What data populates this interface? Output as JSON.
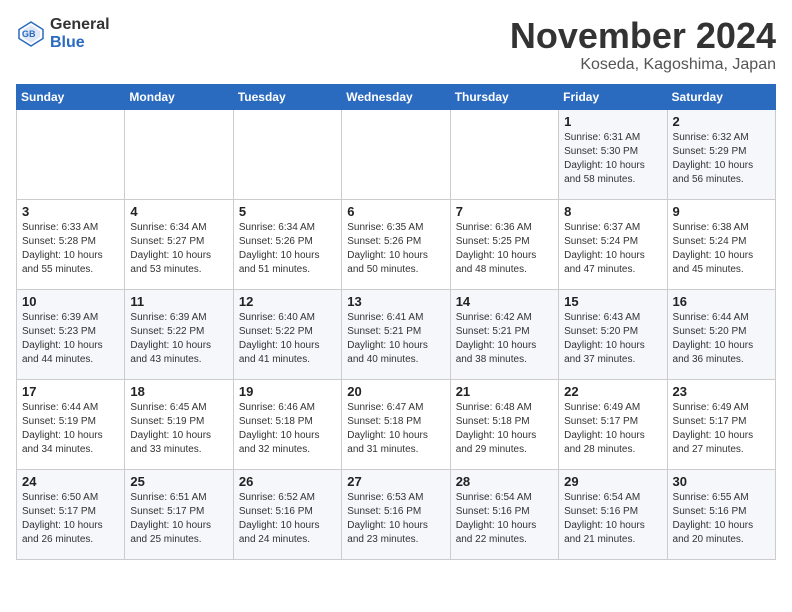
{
  "header": {
    "logo_general": "General",
    "logo_blue": "Blue",
    "month_title": "November 2024",
    "location": "Koseda, Kagoshima, Japan"
  },
  "days_of_week": [
    "Sunday",
    "Monday",
    "Tuesday",
    "Wednesday",
    "Thursday",
    "Friday",
    "Saturday"
  ],
  "weeks": [
    [
      {
        "day": "",
        "sunrise": "",
        "sunset": "",
        "daylight": ""
      },
      {
        "day": "",
        "sunrise": "",
        "sunset": "",
        "daylight": ""
      },
      {
        "day": "",
        "sunrise": "",
        "sunset": "",
        "daylight": ""
      },
      {
        "day": "",
        "sunrise": "",
        "sunset": "",
        "daylight": ""
      },
      {
        "day": "",
        "sunrise": "",
        "sunset": "",
        "daylight": ""
      },
      {
        "day": "1",
        "sunrise": "Sunrise: 6:31 AM",
        "sunset": "Sunset: 5:30 PM",
        "daylight": "Daylight: 10 hours and 58 minutes."
      },
      {
        "day": "2",
        "sunrise": "Sunrise: 6:32 AM",
        "sunset": "Sunset: 5:29 PM",
        "daylight": "Daylight: 10 hours and 56 minutes."
      }
    ],
    [
      {
        "day": "3",
        "sunrise": "Sunrise: 6:33 AM",
        "sunset": "Sunset: 5:28 PM",
        "daylight": "Daylight: 10 hours and 55 minutes."
      },
      {
        "day": "4",
        "sunrise": "Sunrise: 6:34 AM",
        "sunset": "Sunset: 5:27 PM",
        "daylight": "Daylight: 10 hours and 53 minutes."
      },
      {
        "day": "5",
        "sunrise": "Sunrise: 6:34 AM",
        "sunset": "Sunset: 5:26 PM",
        "daylight": "Daylight: 10 hours and 51 minutes."
      },
      {
        "day": "6",
        "sunrise": "Sunrise: 6:35 AM",
        "sunset": "Sunset: 5:26 PM",
        "daylight": "Daylight: 10 hours and 50 minutes."
      },
      {
        "day": "7",
        "sunrise": "Sunrise: 6:36 AM",
        "sunset": "Sunset: 5:25 PM",
        "daylight": "Daylight: 10 hours and 48 minutes."
      },
      {
        "day": "8",
        "sunrise": "Sunrise: 6:37 AM",
        "sunset": "Sunset: 5:24 PM",
        "daylight": "Daylight: 10 hours and 47 minutes."
      },
      {
        "day": "9",
        "sunrise": "Sunrise: 6:38 AM",
        "sunset": "Sunset: 5:24 PM",
        "daylight": "Daylight: 10 hours and 45 minutes."
      }
    ],
    [
      {
        "day": "10",
        "sunrise": "Sunrise: 6:39 AM",
        "sunset": "Sunset: 5:23 PM",
        "daylight": "Daylight: 10 hours and 44 minutes."
      },
      {
        "day": "11",
        "sunrise": "Sunrise: 6:39 AM",
        "sunset": "Sunset: 5:22 PM",
        "daylight": "Daylight: 10 hours and 43 minutes."
      },
      {
        "day": "12",
        "sunrise": "Sunrise: 6:40 AM",
        "sunset": "Sunset: 5:22 PM",
        "daylight": "Daylight: 10 hours and 41 minutes."
      },
      {
        "day": "13",
        "sunrise": "Sunrise: 6:41 AM",
        "sunset": "Sunset: 5:21 PM",
        "daylight": "Daylight: 10 hours and 40 minutes."
      },
      {
        "day": "14",
        "sunrise": "Sunrise: 6:42 AM",
        "sunset": "Sunset: 5:21 PM",
        "daylight": "Daylight: 10 hours and 38 minutes."
      },
      {
        "day": "15",
        "sunrise": "Sunrise: 6:43 AM",
        "sunset": "Sunset: 5:20 PM",
        "daylight": "Daylight: 10 hours and 37 minutes."
      },
      {
        "day": "16",
        "sunrise": "Sunrise: 6:44 AM",
        "sunset": "Sunset: 5:20 PM",
        "daylight": "Daylight: 10 hours and 36 minutes."
      }
    ],
    [
      {
        "day": "17",
        "sunrise": "Sunrise: 6:44 AM",
        "sunset": "Sunset: 5:19 PM",
        "daylight": "Daylight: 10 hours and 34 minutes."
      },
      {
        "day": "18",
        "sunrise": "Sunrise: 6:45 AM",
        "sunset": "Sunset: 5:19 PM",
        "daylight": "Daylight: 10 hours and 33 minutes."
      },
      {
        "day": "19",
        "sunrise": "Sunrise: 6:46 AM",
        "sunset": "Sunset: 5:18 PM",
        "daylight": "Daylight: 10 hours and 32 minutes."
      },
      {
        "day": "20",
        "sunrise": "Sunrise: 6:47 AM",
        "sunset": "Sunset: 5:18 PM",
        "daylight": "Daylight: 10 hours and 31 minutes."
      },
      {
        "day": "21",
        "sunrise": "Sunrise: 6:48 AM",
        "sunset": "Sunset: 5:18 PM",
        "daylight": "Daylight: 10 hours and 29 minutes."
      },
      {
        "day": "22",
        "sunrise": "Sunrise: 6:49 AM",
        "sunset": "Sunset: 5:17 PM",
        "daylight": "Daylight: 10 hours and 28 minutes."
      },
      {
        "day": "23",
        "sunrise": "Sunrise: 6:49 AM",
        "sunset": "Sunset: 5:17 PM",
        "daylight": "Daylight: 10 hours and 27 minutes."
      }
    ],
    [
      {
        "day": "24",
        "sunrise": "Sunrise: 6:50 AM",
        "sunset": "Sunset: 5:17 PM",
        "daylight": "Daylight: 10 hours and 26 minutes."
      },
      {
        "day": "25",
        "sunrise": "Sunrise: 6:51 AM",
        "sunset": "Sunset: 5:17 PM",
        "daylight": "Daylight: 10 hours and 25 minutes."
      },
      {
        "day": "26",
        "sunrise": "Sunrise: 6:52 AM",
        "sunset": "Sunset: 5:16 PM",
        "daylight": "Daylight: 10 hours and 24 minutes."
      },
      {
        "day": "27",
        "sunrise": "Sunrise: 6:53 AM",
        "sunset": "Sunset: 5:16 PM",
        "daylight": "Daylight: 10 hours and 23 minutes."
      },
      {
        "day": "28",
        "sunrise": "Sunrise: 6:54 AM",
        "sunset": "Sunset: 5:16 PM",
        "daylight": "Daylight: 10 hours and 22 minutes."
      },
      {
        "day": "29",
        "sunrise": "Sunrise: 6:54 AM",
        "sunset": "Sunset: 5:16 PM",
        "daylight": "Daylight: 10 hours and 21 minutes."
      },
      {
        "day": "30",
        "sunrise": "Sunrise: 6:55 AM",
        "sunset": "Sunset: 5:16 PM",
        "daylight": "Daylight: 10 hours and 20 minutes."
      }
    ]
  ]
}
